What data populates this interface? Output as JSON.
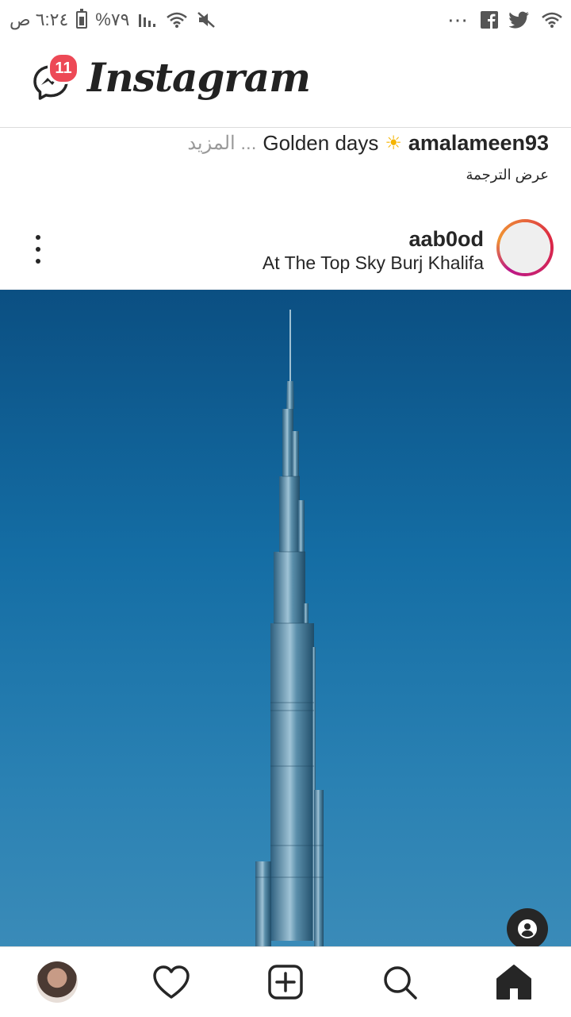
{
  "status_bar": {
    "time": "٦:٢٤ ص",
    "battery": "%٧٩",
    "icons": [
      "battery-icon",
      "signal-icon",
      "wifi-icon",
      "mute-icon",
      "more-dots-icon",
      "facebook-icon",
      "twitter-icon",
      "wifi-icon"
    ]
  },
  "header": {
    "logo": "Instagram",
    "messages_badge": "11"
  },
  "caption": {
    "username": "amalameen93",
    "emoji": "☀",
    "text": "Golden days",
    "more": "المزيد ...",
    "translate": "عرض الترجمة"
  },
  "post": {
    "username": "aab0od",
    "location": "At The Top Sky Burj Khalifa"
  },
  "bottom_nav": {
    "items": [
      "profile",
      "activity-heart",
      "new-post",
      "search",
      "home"
    ]
  },
  "colors": {
    "badge": "#ed4956",
    "sky_top": "#0b4f82",
    "sky_bottom": "#3a8bb8",
    "story_ring": "#dc2743"
  }
}
